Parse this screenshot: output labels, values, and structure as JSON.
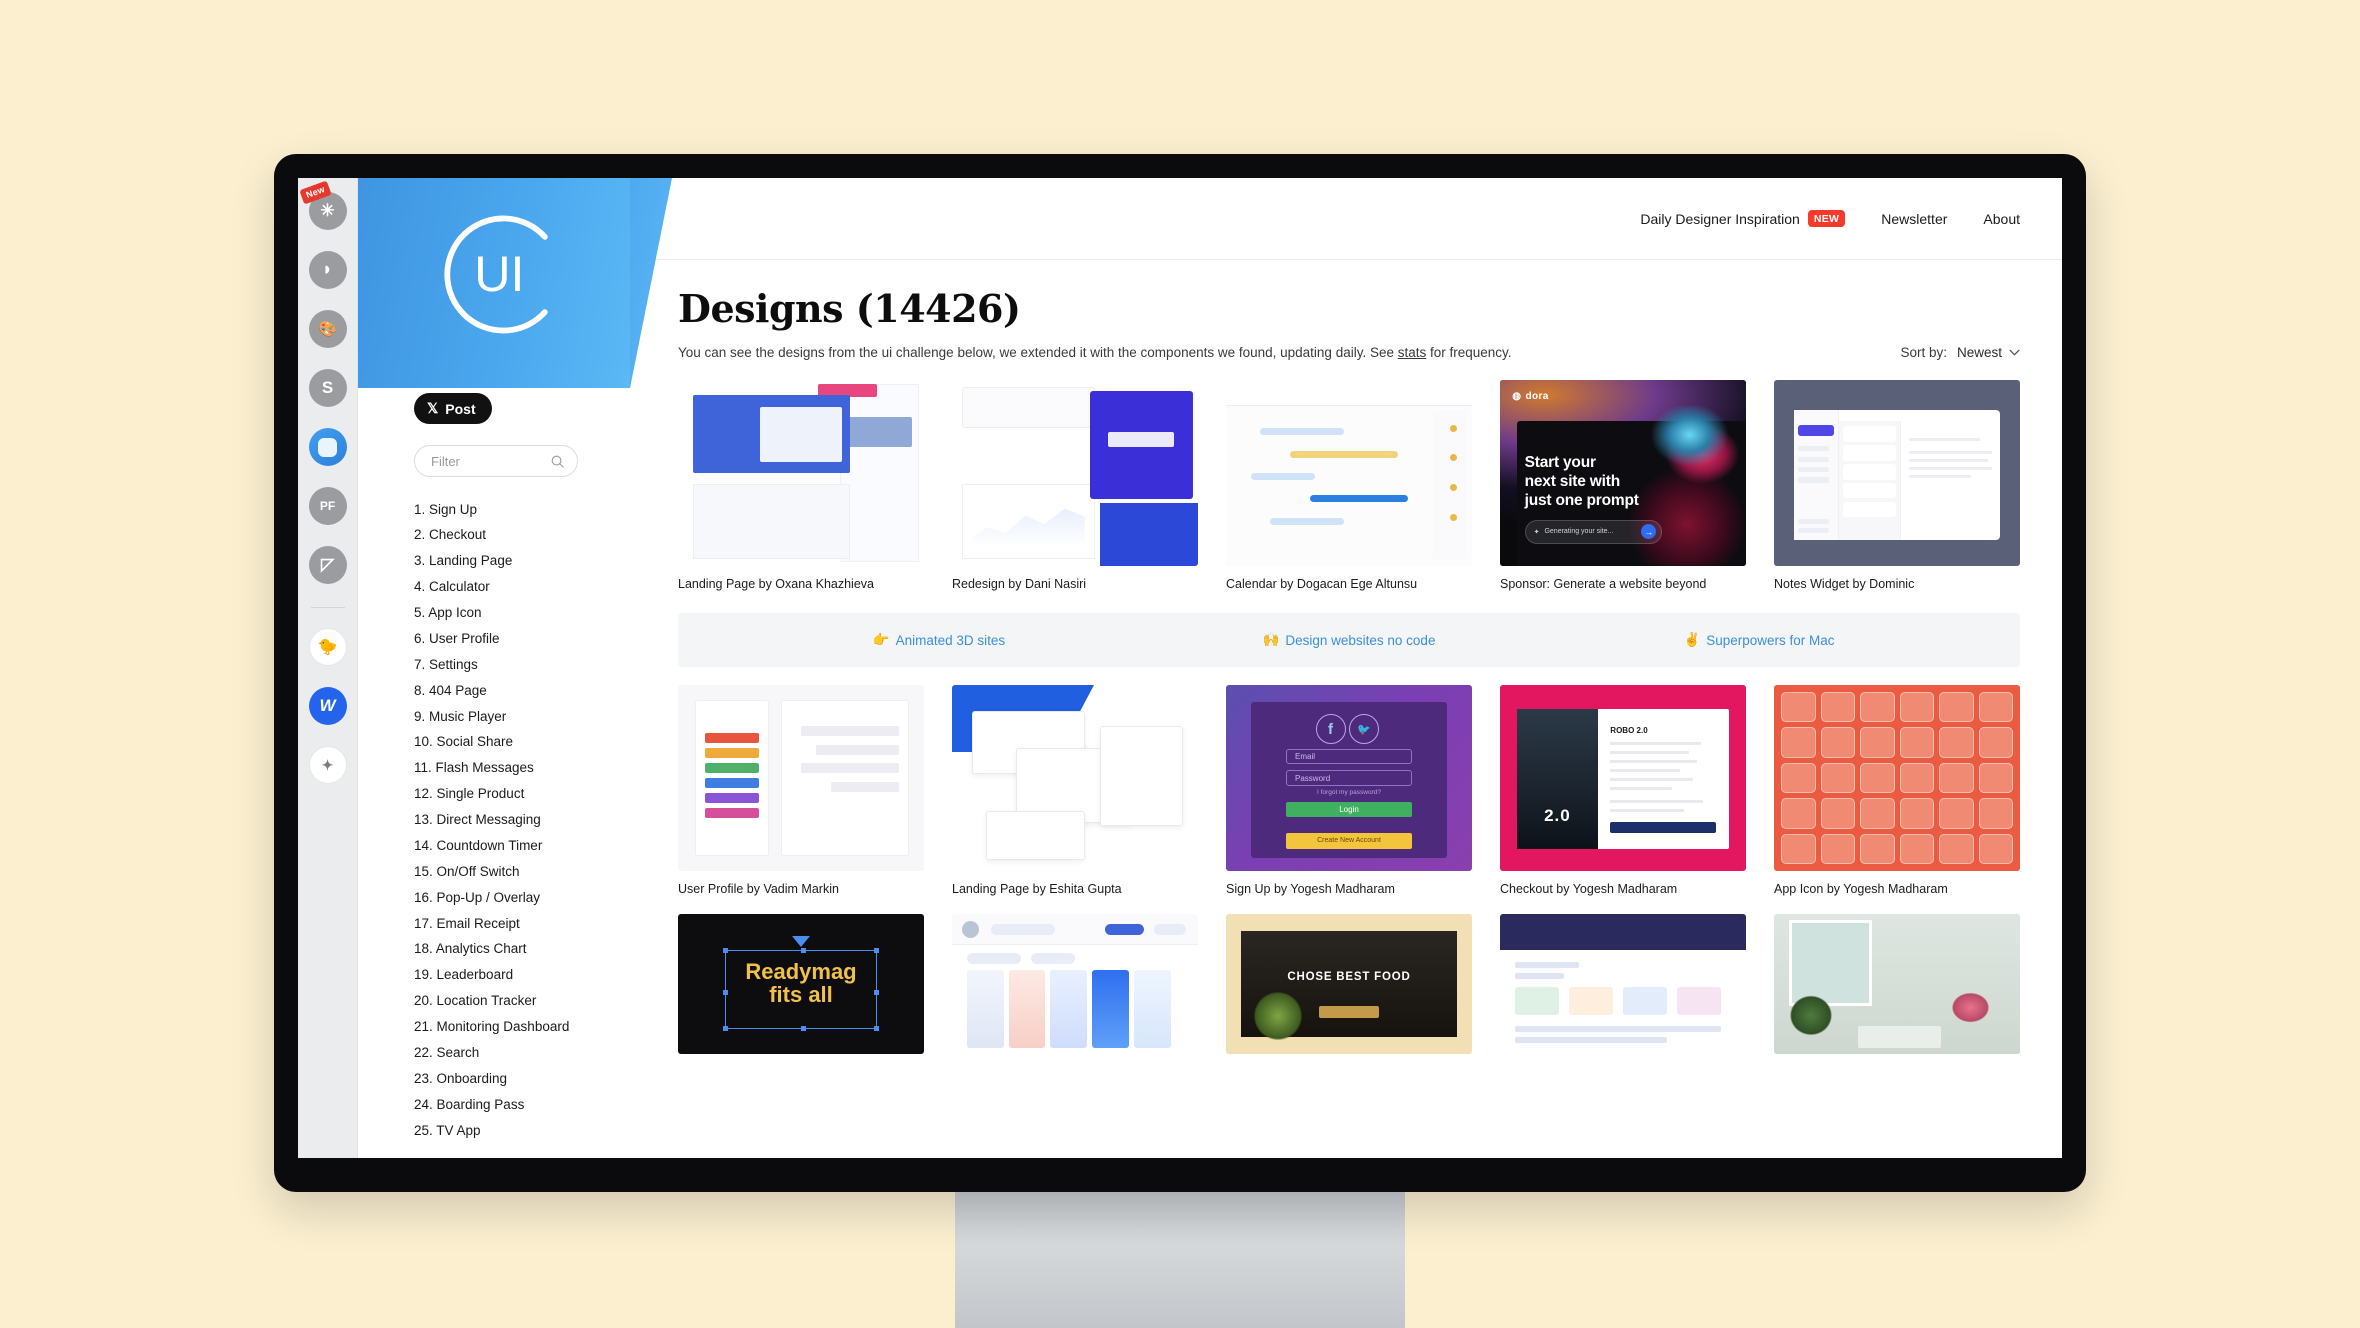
{
  "rail": {
    "items": [
      {
        "name": "asterisk-extension",
        "glyph": "✳",
        "badge": "New"
      },
      {
        "name": "pocket-extension",
        "glyph": "◗"
      },
      {
        "name": "palette-extension",
        "glyph": "🎨"
      },
      {
        "name": "s-extension",
        "glyph": "S"
      },
      {
        "name": "collectui-extension",
        "glyph": ""
      },
      {
        "name": "pf-extension",
        "glyph": "PF"
      },
      {
        "name": "wave-extension",
        "glyph": "◸"
      },
      {
        "name": "bird-extension",
        "glyph": "🐤"
      },
      {
        "name": "webflow-extension",
        "glyph": "W"
      },
      {
        "name": "sparkle-extension",
        "glyph": "✦"
      }
    ]
  },
  "nav": {
    "daily_label": "Daily Designer Inspiration",
    "daily_badge": "NEW",
    "newsletter_label": "Newsletter",
    "about_label": "About"
  },
  "left": {
    "logo_text": "UI",
    "post_label": "Post",
    "post_icon": "𝕏",
    "filter_placeholder": "Filter",
    "filter_value": "",
    "search_icon": "search-icon",
    "challenges": [
      "1. Sign Up",
      "2. Checkout",
      "3. Landing Page",
      "4. Calculator",
      "5. App Icon",
      "6. User Profile",
      "7. Settings",
      "8. 404 Page",
      "9. Music Player",
      "10. Social Share",
      "11. Flash Messages",
      "12. Single Product",
      "13. Direct Messaging",
      "14. Countdown Timer",
      "15. On/Off Switch",
      "16. Pop-Up / Overlay",
      "17. Email Receipt",
      "18. Analytics Chart",
      "19. Leaderboard",
      "20. Location Tracker",
      "21. Monitoring Dashboard",
      "22. Search",
      "23. Onboarding",
      "24. Boarding Pass",
      "25. TV App"
    ]
  },
  "main": {
    "title": "Designs (14426)",
    "subtitle_before": "You can see the designs from the ui challenge below, we extended it with the components we found, updating daily. See ",
    "subtitle_link": "stats",
    "subtitle_after": " for frequency.",
    "sort_label": "Sort by:",
    "sort_value": "Newest",
    "sort_caret": "chevron-down-icon"
  },
  "promo": [
    {
      "emoji": "👉",
      "label": "Animated 3D sites"
    },
    {
      "emoji": "🙌",
      "label": "Design websites no code"
    },
    {
      "emoji": "✌️",
      "label": "Superpowers for Mac"
    }
  ],
  "row1": [
    {
      "caption": "Landing Page by Oxana Khazhieva"
    },
    {
      "caption": "Redesign by Dani Nasiri"
    },
    {
      "caption": "Calendar by Dogacan Ege Altunsu"
    },
    {
      "caption": "Sponsor: Generate a website beyond",
      "art": {
        "logo": "dora",
        "headline": "Start your\nnext site with\njust one prompt",
        "pill": "Generating your site...",
        "arrow": "→"
      }
    },
    {
      "caption": "Notes Widget by Dominic"
    }
  ],
  "row2": [
    {
      "caption": "User Profile by Vadim Markin"
    },
    {
      "caption": "Landing Page by Eshita Gupta"
    },
    {
      "caption": "Sign Up by Yogesh Madharam",
      "art": {
        "email": "Email",
        "password": "Password",
        "forgot": "I forgot my password?",
        "login": "Login",
        "create": "Create New Account",
        "fb": "f",
        "tw": "🐦"
      }
    },
    {
      "caption": "Checkout by Yogesh Madharam",
      "art": {
        "poster_title": "2.0",
        "order_title": "ROBO 2.0"
      }
    },
    {
      "caption": "App Icon by Yogesh Madharam"
    }
  ],
  "row3": [
    {
      "caption": "",
      "art": {
        "text": "Readymag\nfits all"
      }
    },
    {
      "caption": ""
    },
    {
      "caption": "",
      "art": {
        "text": "CHOSE BEST FOOD"
      }
    },
    {
      "caption": ""
    },
    {
      "caption": ""
    }
  ],
  "colors": {
    "page_bg": "#fbefd0",
    "hero_blue": "#4aa7ee",
    "accent_red": "#f5392b",
    "promo_link": "#3b8fdd"
  }
}
